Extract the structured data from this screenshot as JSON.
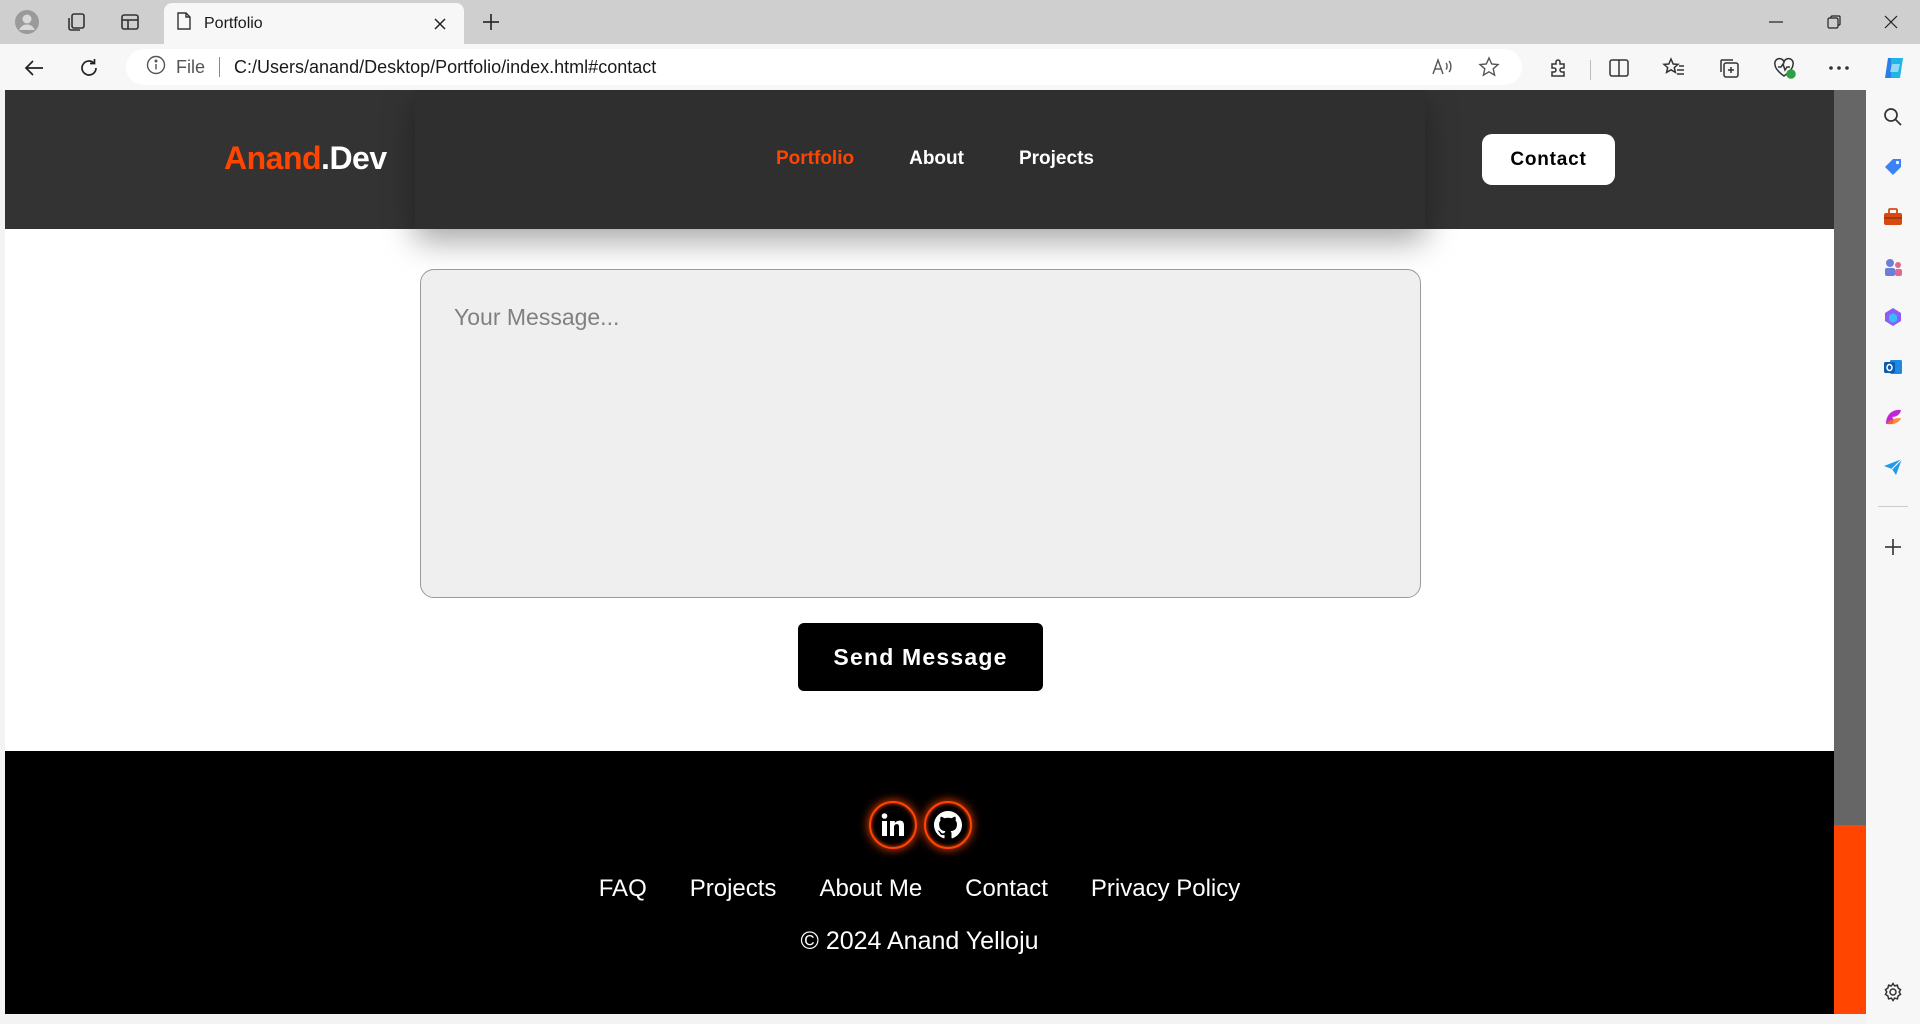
{
  "browser": {
    "tab_title": "Portfolio",
    "address_scheme": "File",
    "address_url": "C:/Users/anand/Desktop/Portfolio/index.html#contact"
  },
  "site": {
    "logo_accent": "Anand",
    "logo_rest": ".Dev",
    "accent_color": "#ff4500",
    "nav": [
      "Portfolio",
      "About",
      "Projects"
    ],
    "active_nav": "Portfolio",
    "contact_button": "Contact"
  },
  "form": {
    "message_placeholder": "Your Message...",
    "send_button": "Send Message"
  },
  "footer": {
    "social_icons": [
      "linkedin-icon",
      "github-icon"
    ],
    "links": [
      "FAQ",
      "Projects",
      "About Me",
      "Contact",
      "Privacy Policy"
    ],
    "copyright": "© 2024 Anand Yelloju"
  }
}
